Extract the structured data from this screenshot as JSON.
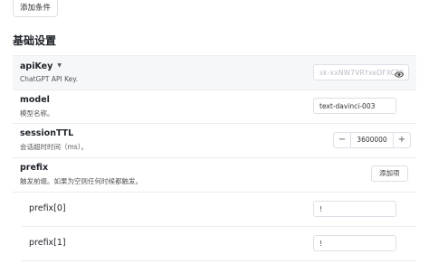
{
  "header": {
    "add_condition_label": "添加条件"
  },
  "section": {
    "title": "基础设置"
  },
  "fields": {
    "apiKey": {
      "name": "apiKey",
      "desc": "ChatGPT API Key.",
      "value": "sk-xxNW7VRYxeDFXCF5",
      "caret": "▼"
    },
    "model": {
      "name": "model",
      "desc": "模型名称。",
      "value": "text-davinci-003"
    },
    "sessionTTL": {
      "name": "sessionTTL",
      "desc": "会话超时时间（ms）。",
      "value": "3600000",
      "minus": "−",
      "plus": "+"
    },
    "prefix": {
      "name": "prefix",
      "desc": "触发前缀。如果为空则任何时候都触发。",
      "add_label": "添加项"
    },
    "prefix0": {
      "name": "prefix[0]",
      "value": "!"
    },
    "prefix1": {
      "name": "prefix[1]",
      "value": "!"
    }
  }
}
